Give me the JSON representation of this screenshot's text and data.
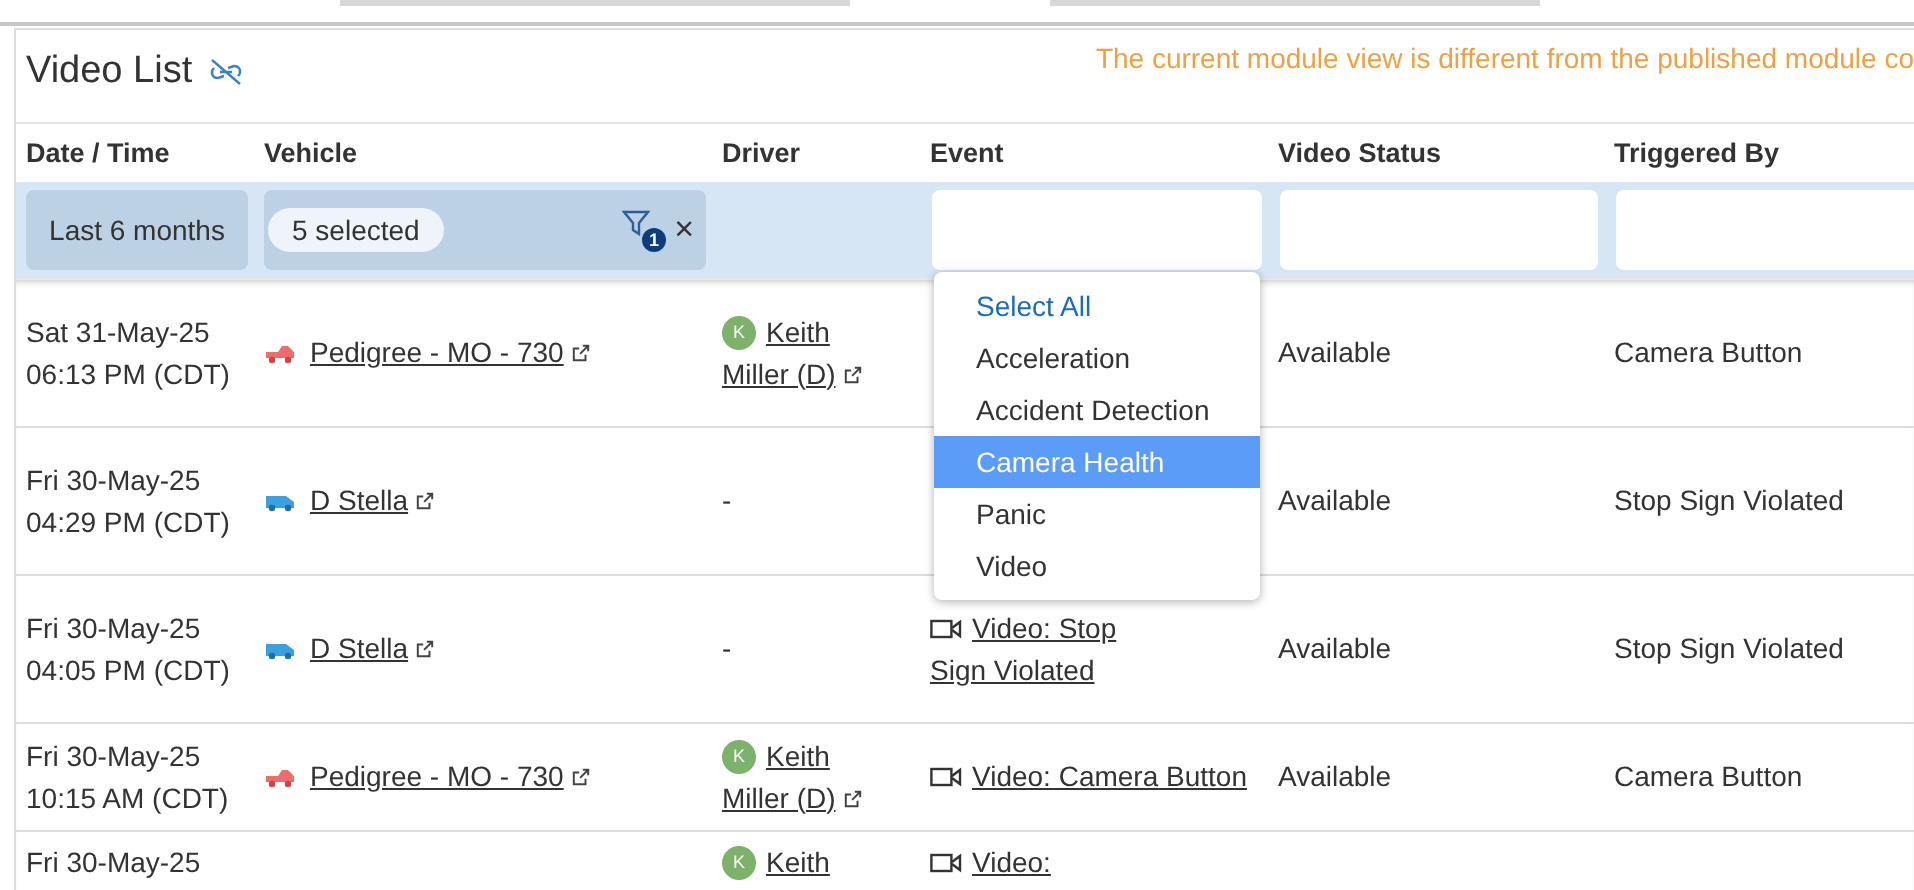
{
  "panel": {
    "title": "Video List",
    "notice": "The current module view is different from the published module co"
  },
  "table": {
    "columns": [
      "Date / Time",
      "Vehicle",
      "Driver",
      "Event",
      "Video Status",
      "Triggered By"
    ],
    "filters": {
      "date": "Last 6 months",
      "vehicle_chip": "5 selected",
      "vehicle_filter_count": "1",
      "clear": "×"
    },
    "rows": [
      {
        "date": "Sat 31-May-25",
        "time": "06:13 PM (CDT)",
        "vehicle": {
          "kind": "car",
          "name": "Pedigree - MO - 730"
        },
        "driver": {
          "initial": "K",
          "first": "Keith",
          "last": "Miller (D)"
        },
        "status": "Available",
        "triggered_by": "Camera Button"
      },
      {
        "date": "Fri 30-May-25",
        "time": "04:29 PM (CDT)",
        "vehicle": {
          "kind": "van",
          "name": "D Stella"
        },
        "driver_text": "-",
        "status": "Available",
        "triggered_by": "Stop Sign Violated"
      },
      {
        "date": "Fri 30-May-25",
        "time": "04:05 PM (CDT)",
        "vehicle": {
          "kind": "van",
          "name": "D Stella"
        },
        "driver_text": "-",
        "event": {
          "first": "Video: Stop",
          "rest": "Sign Violated"
        },
        "status": "Available",
        "triggered_by": "Stop Sign Violated"
      },
      {
        "date": "Fri 30-May-25",
        "time": "10:15 AM (CDT)",
        "vehicle": {
          "kind": "car",
          "name": "Pedigree - MO - 730"
        },
        "driver": {
          "initial": "K",
          "first": "Keith",
          "last": "Miller (D)"
        },
        "event": {
          "first": "Video: Camera Button"
        },
        "status": "Available",
        "triggered_by": "Camera Button"
      },
      {
        "date": "Fri 30-May-25",
        "driver": {
          "initial": "K",
          "first": "Keith"
        },
        "event": {
          "first": "Video:"
        }
      }
    ]
  },
  "event_filter_menu": {
    "items": [
      {
        "label": "Select All",
        "kind": "select_all",
        "selected": false
      },
      {
        "label": "Acceleration",
        "kind": "option",
        "selected": false
      },
      {
        "label": "Accident Detection",
        "kind": "option",
        "selected": false
      },
      {
        "label": "Camera Health",
        "kind": "option",
        "selected": true
      },
      {
        "label": "Panic",
        "kind": "option",
        "selected": false
      },
      {
        "label": "Video",
        "kind": "option",
        "selected": false
      }
    ]
  }
}
